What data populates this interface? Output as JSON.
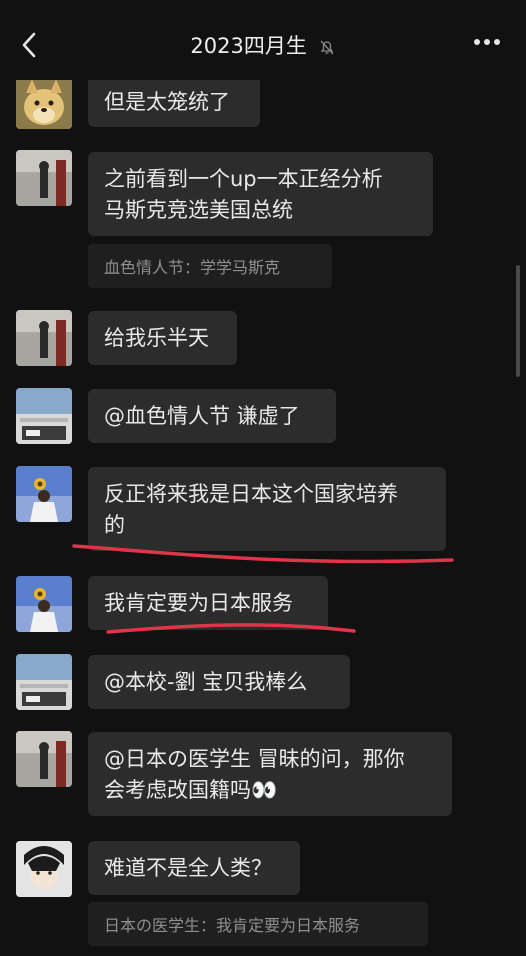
{
  "header": {
    "title": "2023四月生",
    "icons": {
      "back": "back-chevron-icon",
      "mute": "mute-bell-icon",
      "more": "more-dots-icon"
    }
  },
  "messages": [
    {
      "text": "但是太笼统了"
    },
    {
      "text_line1": "之前看到一个up一本正经分析",
      "text_line2": "马斯克竞选美国总统",
      "quote": "血色情人节：学学马斯克"
    },
    {
      "text": "给我乐半天"
    },
    {
      "text": "@血色情人节 谦虚了"
    },
    {
      "text_line1": "反正将来我是日本这个国家培养",
      "text_line2": "的"
    },
    {
      "text": "我肯定要为日本服务"
    },
    {
      "text": "@本校-劉 宝贝我棒么"
    },
    {
      "text_line1": "@日本の医学生 冒昧的问，那你",
      "text_line2": "会考虑改国籍吗👀"
    },
    {
      "text": "难道不是全人类？",
      "quote": "日本の医学生：我肯定要为日本服务"
    }
  ],
  "colors": {
    "background": "#111111",
    "bubble": "#2c2c2c",
    "quote_bg": "#1f1f1f",
    "markup_red": "#e0344a"
  }
}
